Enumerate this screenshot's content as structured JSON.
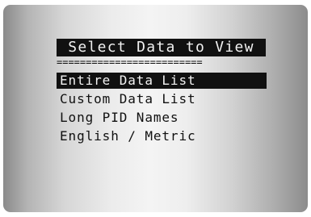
{
  "screen": {
    "title": "Select Data to View",
    "divider": "=========================",
    "menu": [
      {
        "label": "Entire Data List",
        "selected": true
      },
      {
        "label": "Custom Data List",
        "selected": false
      },
      {
        "label": "Long PID Names",
        "selected": false
      },
      {
        "label": "English / Metric",
        "selected": false
      }
    ]
  },
  "colors": {
    "highlight": "#111111",
    "highlight_text": "#f2f2f2",
    "text": "#111111"
  }
}
